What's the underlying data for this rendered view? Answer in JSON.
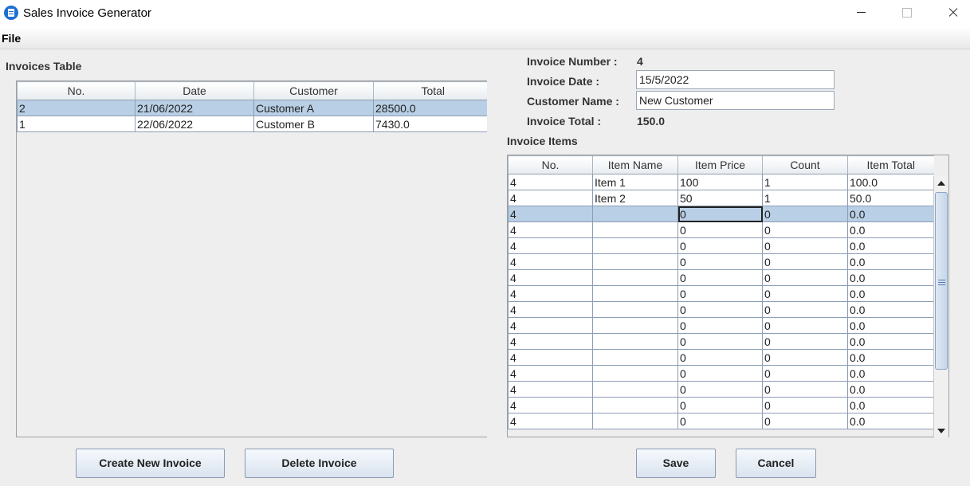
{
  "window": {
    "title": "Sales Invoice Generator",
    "controls": [
      "minimize",
      "maximize",
      "close"
    ]
  },
  "menu": {
    "file": "File"
  },
  "invoices_table": {
    "title": "Invoices Table",
    "columns": [
      "No.",
      "Date",
      "Customer",
      "Total"
    ],
    "rows": [
      [
        "2",
        "21/06/2022",
        "Customer A",
        "28500.0"
      ],
      [
        "1",
        "22/06/2022",
        "Customer B",
        "7430.0"
      ]
    ],
    "selected_row": 0
  },
  "invoice_header": {
    "number_label": "Invoice Number :",
    "number_value": "4",
    "date_label": "Invoice Date :",
    "date_value": "15/5/2022",
    "customer_label": "Customer Name :",
    "customer_value": "New Customer",
    "total_label": "Invoice Total :",
    "total_value": "150.0"
  },
  "invoice_items": {
    "title": "Invoice Items",
    "columns": [
      "No.",
      "Item Name",
      "Item Price",
      "Count",
      "Item Total"
    ],
    "rows": [
      [
        "4",
        "Item 1",
        "100",
        "1",
        "100.0"
      ],
      [
        "4",
        "Item 2",
        "50",
        "1",
        "50.0"
      ],
      [
        "4",
        "",
        "0",
        "0",
        "0.0"
      ],
      [
        "4",
        "",
        "0",
        "0",
        "0.0"
      ],
      [
        "4",
        "",
        "0",
        "0",
        "0.0"
      ],
      [
        "4",
        "",
        "0",
        "0",
        "0.0"
      ],
      [
        "4",
        "",
        "0",
        "0",
        "0.0"
      ],
      [
        "4",
        "",
        "0",
        "0",
        "0.0"
      ],
      [
        "4",
        "",
        "0",
        "0",
        "0.0"
      ],
      [
        "4",
        "",
        "0",
        "0",
        "0.0"
      ],
      [
        "4",
        "",
        "0",
        "0",
        "0.0"
      ],
      [
        "4",
        "",
        "0",
        "0",
        "0.0"
      ],
      [
        "4",
        "",
        "0",
        "0",
        "0.0"
      ],
      [
        "4",
        "",
        "0",
        "0",
        "0.0"
      ],
      [
        "4",
        "",
        "0",
        "0",
        "0.0"
      ],
      [
        "4",
        "",
        "0",
        "0",
        "0.0"
      ]
    ],
    "selected_row": 2,
    "editing_cell": {
      "row": 2,
      "col": 2
    }
  },
  "buttons": {
    "create": "Create New Invoice",
    "delete": "Delete Invoice",
    "save": "Save",
    "cancel": "Cancel"
  },
  "colors": {
    "selection": "#b8cfe5",
    "grid_line": "#8d9db4",
    "window_bg": "#eeeeee"
  }
}
